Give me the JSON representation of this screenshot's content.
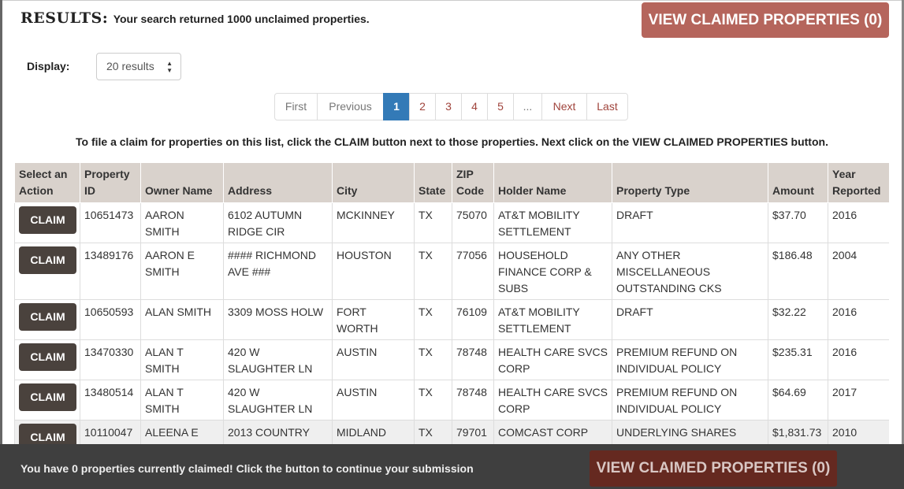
{
  "header": {
    "results_title": "RESULTS:",
    "results_text": "Your search returned 1000 unclaimed properties.",
    "view_claimed_label": "VIEW CLAIMED PROPERTIES (0)"
  },
  "display": {
    "label": "Display:",
    "selected": "20 results"
  },
  "pagination": {
    "first": "First",
    "previous": "Previous",
    "pages": [
      "1",
      "2",
      "3",
      "4",
      "5"
    ],
    "ellipsis": "...",
    "next": "Next",
    "last": "Last",
    "active_page": "1"
  },
  "instructions": "To file a claim for properties on this list, click the CLAIM button next to those properties. Next click on the VIEW CLAIMED PROPERTIES button.",
  "table": {
    "headers": [
      "Select an Action",
      "Property ID",
      "Owner Name",
      "Address",
      "City",
      "State",
      "ZIP Code",
      "Holder Name",
      "Property Type",
      "Amount",
      "Year Reported"
    ],
    "claim_label": "CLAIM",
    "rows": [
      {
        "id": "10651473",
        "owner": "AARON SMITH",
        "address": "6102 AUTUMN RIDGE CIR",
        "city": "MCKINNEY",
        "state": "TX",
        "zip": "75070",
        "holder": "AT&T MOBILITY SETTLEMENT",
        "type": "DRAFT",
        "amount": "$37.70",
        "year": "2016"
      },
      {
        "id": "13489176",
        "owner": "AARON E SMITH",
        "address": "#### RICHMOND AVE ###",
        "city": "HOUSTON",
        "state": "TX",
        "zip": "77056",
        "holder": "HOUSEHOLD FINANCE CORP & SUBS",
        "type": "ANY OTHER MISCELLANEOUS OUTSTANDING CKS",
        "amount": "$186.48",
        "year": "2004"
      },
      {
        "id": "10650593",
        "owner": "ALAN SMITH",
        "address": "3309 MOSS HOLW",
        "city": "FORT WORTH",
        "state": "TX",
        "zip": "76109",
        "holder": "AT&T MOBILITY SETTLEMENT",
        "type": "DRAFT",
        "amount": "$32.22",
        "year": "2016"
      },
      {
        "id": "13470330",
        "owner": "ALAN T SMITH",
        "address": "420 W SLAUGHTER LN",
        "city": "AUSTIN",
        "state": "TX",
        "zip": "78748",
        "holder": "HEALTH CARE SVCS CORP",
        "type": "PREMIUM REFUND ON INDIVIDUAL POLICY",
        "amount": "$235.31",
        "year": "2016"
      },
      {
        "id": "13480514",
        "owner": "ALAN T SMITH",
        "address": "420 W SLAUGHTER LN",
        "city": "AUSTIN",
        "state": "TX",
        "zip": "78748",
        "holder": "HEALTH CARE SVCS CORP",
        "type": "PREMIUM REFUND ON INDIVIDUAL POLICY",
        "amount": "$64.69",
        "year": "2017"
      },
      {
        "id": "10110047",
        "owner": "ALEENA E",
        "address": "2013 COUNTRY",
        "city": "MIDLAND",
        "state": "TX",
        "zip": "79701",
        "holder": "COMCAST CORP",
        "type": "UNDERLYING SHARES",
        "amount": "$1,831.73",
        "year": "2010"
      }
    ]
  },
  "bottom_bar": {
    "message": "You have 0 properties currently claimed! Click the button to continue your submission",
    "view_claimed_label": "VIEW CLAIMED PROPERTIES (0)"
  },
  "colors": {
    "accent_button": "#b5655c",
    "accent_button_dark": "#652920",
    "active_page": "#337ab7",
    "claim_button": "#4a423d",
    "table_header": "#d9d2cc",
    "bottom_bar": "#3f3f3f"
  }
}
